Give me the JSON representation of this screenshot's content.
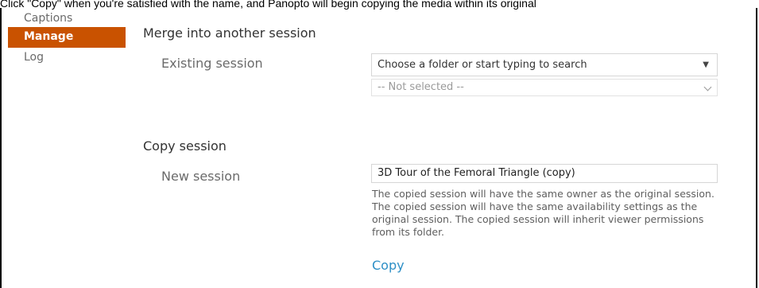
{
  "top_caption": "Click \"Copy\" when you're satisfied with the name, and Panopto will begin copying the media within its original",
  "sidebar": {
    "items": [
      {
        "label": "Captions",
        "active": false
      },
      {
        "label": "Manage",
        "active": true
      },
      {
        "label": "Log",
        "active": false
      }
    ]
  },
  "merge": {
    "title": "Merge into another session",
    "existing_label": "Existing session",
    "folder_placeholder": "Choose a folder or start typing to search",
    "session_value": "-- Not selected --"
  },
  "copy": {
    "title": "Copy session",
    "new_label": "New session",
    "new_value": "3D Tour of the Femoral Triangle (copy)",
    "help": "The copied session will have the same owner as the original session. The copied session will have the same availability settings as the original session. The copied session will inherit viewer permissions from its folder.",
    "button": "Copy"
  },
  "colors": {
    "active_sidebar": "#c95200",
    "link": "#2d8fc6"
  }
}
